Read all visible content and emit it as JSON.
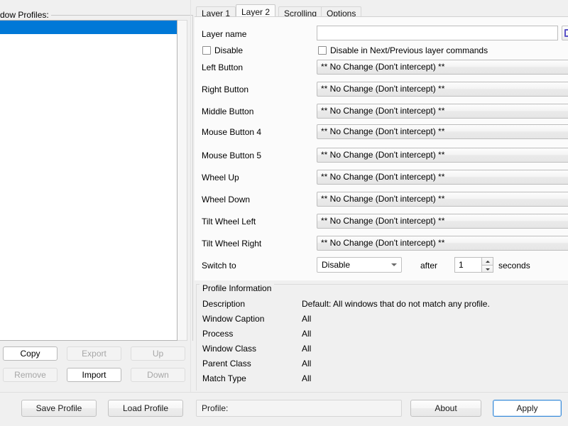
{
  "left_panel": {
    "group_label": "dow Profiles:",
    "profiles": [
      {
        "name": "",
        "selected": true
      },
      {
        "name": "",
        "selected": false
      }
    ],
    "buttons": [
      {
        "label": "Copy",
        "state": "enabled"
      },
      {
        "label": "Export",
        "state": "disabled"
      },
      {
        "label": "Up",
        "state": "disabled"
      },
      {
        "label": "Remove",
        "state": "disabled"
      },
      {
        "label": "Import",
        "state": "enabled"
      },
      {
        "label": "Down",
        "state": "disabled"
      }
    ]
  },
  "tabs": [
    {
      "label": "Layer 1",
      "active": false
    },
    {
      "label": "Layer 2",
      "active": true
    },
    {
      "label": "Scrolling",
      "active": false
    },
    {
      "label": "Options",
      "active": false
    }
  ],
  "layer_form": {
    "layer_name_label": "Layer name",
    "layer_name_value": "",
    "layer_name_placeholder": "",
    "disable_label": "Disable",
    "disable_checked": false,
    "disable_nextprev_label": "Disable in Next/Previous layer commands",
    "disable_nextprev_checked": false,
    "no_change_value": "** No Change (Don't intercept) **",
    "bindings": [
      {
        "label": "Left Button",
        "value": "** No Change (Don't intercept) **"
      },
      {
        "label": "Right Button",
        "value": "** No Change (Don't intercept) **"
      },
      {
        "label": "Middle Button",
        "value": "** No Change (Don't intercept) **"
      },
      {
        "label": "Mouse Button 4",
        "value": "** No Change (Don't intercept) **"
      },
      {
        "label": "Mouse Button 5",
        "value": "** No Change (Don't intercept) **"
      },
      {
        "label": "Wheel Up",
        "value": "** No Change (Don't intercept) **"
      },
      {
        "label": "Wheel Down",
        "value": "** No Change (Don't intercept) **"
      },
      {
        "label": "Tilt Wheel Left",
        "value": "** No Change (Don't intercept) **"
      },
      {
        "label": "Tilt Wheel Right",
        "value": "** No Change (Don't intercept) **"
      }
    ],
    "switch_to_label": "Switch to",
    "switch_to_value": "Disable",
    "after_label": "after",
    "after_value": "1",
    "seconds_label": "seconds"
  },
  "profile_information": {
    "group_label": "Profile Information",
    "rows": [
      {
        "label": "Description",
        "value": "Default: All windows that do not match any profile."
      },
      {
        "label": "Window Caption",
        "value": "All"
      },
      {
        "label": "Process",
        "value": "All"
      },
      {
        "label": "Window Class",
        "value": "All"
      },
      {
        "label": "Parent Class",
        "value": "All"
      },
      {
        "label": "Match Type",
        "value": "All"
      }
    ]
  },
  "bottom_bar": {
    "save_profile": "Save Profile",
    "load_profile": "Load Profile",
    "profile_status": "Profile:",
    "about": "About",
    "apply": "Apply"
  },
  "colors": {
    "selection_blue": "#0078d7",
    "window_bg": "#f0f0f0",
    "tabpage_bg": "#fbfbfb",
    "focus_border": "#3c8ddb",
    "browse_glyph": "#5b53c8"
  }
}
